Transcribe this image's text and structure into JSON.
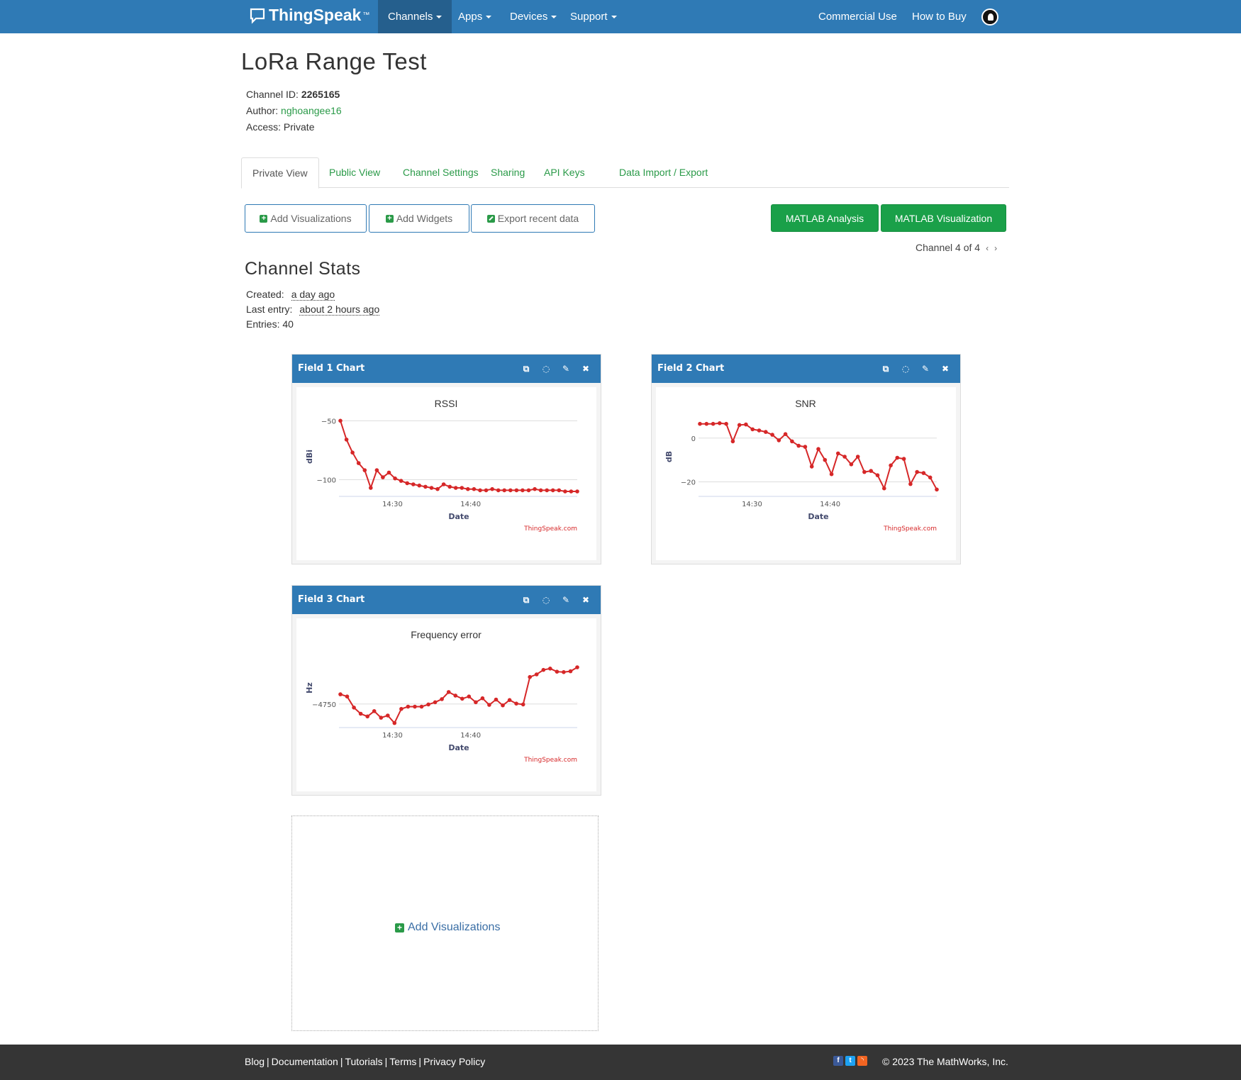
{
  "nav": {
    "brand": "ThingSpeak",
    "brand_tm": "™",
    "channels": "Channels",
    "apps": "Apps",
    "devices": "Devices",
    "support": "Support",
    "commercial": "Commercial Use",
    "how_to_buy": "How to Buy"
  },
  "channel": {
    "title": "LoRa Range Test",
    "id_label": "Channel ID: ",
    "id": "2265165",
    "author_label": "Author: ",
    "author": "nghoangee16",
    "access": "Access: Private"
  },
  "tabs": [
    "Private View",
    "Public View",
    "Channel Settings",
    "Sharing",
    "API Keys",
    "Data Import / Export"
  ],
  "toolbar": {
    "add_viz": "Add Visualizations",
    "add_widgets": "Add Widgets",
    "export": "Export recent data",
    "matlab_analysis": "MATLAB Analysis",
    "matlab_viz": "MATLAB Visualization",
    "pager": "Channel 4 of 4"
  },
  "stats": {
    "title": "Channel Stats",
    "created_label": "Created:",
    "created": "a day ago",
    "last_label": "Last entry:",
    "last": "about 2 hours ago",
    "entries": "Entries: 40"
  },
  "widgets": [
    {
      "header": "Field 1 Chart"
    },
    {
      "header": "Field 2 Chart"
    },
    {
      "header": "Field 3 Chart"
    }
  ],
  "chart_data": [
    {
      "type": "line",
      "title": "RSSI",
      "xlabel": "Date",
      "ylabel": "dBi",
      "credit": "ThingSpeak.com",
      "yticks": [
        -50,
        -100
      ],
      "xticks": [
        "14:30",
        "14:40"
      ],
      "ylim": [
        -113,
        -48
      ],
      "values": [
        -50,
        -66,
        -77,
        -86,
        -92,
        -107,
        -92,
        -98,
        -94,
        -99,
        -101,
        -103,
        -104,
        -105,
        -106,
        -107,
        -108,
        -104,
        -106,
        -107,
        -107,
        -108,
        -108,
        -109,
        -109,
        -108,
        -109,
        -109,
        -109,
        -109,
        -109,
        -109,
        -108,
        -109,
        -109,
        -109,
        -109,
        -110,
        -110,
        -110
      ],
      "color": "#d62728"
    },
    {
      "type": "line",
      "title": "SNR",
      "xlabel": "Date",
      "ylabel": "dB",
      "credit": "ThingSpeak.com",
      "yticks": [
        0,
        -20
      ],
      "xticks": [
        "14:30",
        "14:40"
      ],
      "ylim": [
        -26,
        9
      ],
      "values": [
        6.5,
        6.5,
        6.5,
        6.8,
        6.5,
        -1.5,
        6.0,
        6.2,
        4.0,
        3.5,
        2.8,
        1.5,
        -1.0,
        1.8,
        -1.5,
        -3.5,
        -4.0,
        -13.0,
        -5.0,
        -10.0,
        -16.5,
        -7.0,
        -8.5,
        -12.0,
        -8.5,
        -15.5,
        -15.0,
        -17.0,
        -23.0,
        -12.5,
        -9.0,
        -9.5,
        -21.0,
        -15.5,
        -16.0,
        -18.0,
        -23.5
      ],
      "color": "#d62728"
    },
    {
      "type": "line",
      "title": "Frequency error",
      "xlabel": "Date",
      "ylabel": "Hz",
      "credit": "ThingSpeak.com",
      "yticks": [
        -4750
      ],
      "xticks": [
        "14:30",
        "14:40"
      ],
      "ylim": [
        -4800,
        -4627
      ],
      "values": [
        -4728,
        -4733,
        -4758,
        -4772,
        -4778,
        -4766,
        -4781,
        -4776,
        -4793,
        -4761,
        -4756,
        -4756,
        -4756,
        -4751,
        -4746,
        -4739,
        -4723,
        -4731,
        -4738,
        -4733,
        -4746,
        -4737,
        -4752,
        -4740,
        -4753,
        -4741,
        -4749,
        -4751,
        -4689,
        -4683,
        -4673,
        -4670,
        -4677,
        -4678,
        -4676,
        -4667
      ],
      "color": "#d62728"
    }
  ],
  "add_box": {
    "label": "Add Visualizations"
  },
  "footer": {
    "blog": "Blog",
    "docs": "Documentation",
    "tutorials": "Tutorials",
    "terms": "Terms",
    "privacy": "Privacy Policy",
    "copyright": "© 2023 The MathWorks, Inc."
  }
}
